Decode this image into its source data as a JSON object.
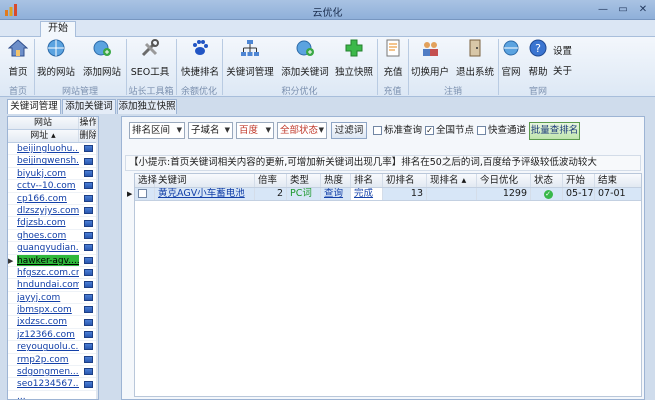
{
  "window": {
    "title": "云优化",
    "controls": [
      "—",
      "▭",
      "✕"
    ]
  },
  "menu": {
    "tab": "开始"
  },
  "ribbon": {
    "buttons": [
      {
        "id": "home",
        "label": "首页",
        "icon": "home-icon"
      },
      {
        "id": "my-sites",
        "label": "我的网站",
        "icon": "globe-icon"
      },
      {
        "id": "add-site",
        "label": "添加网站",
        "icon": "globe-add-icon"
      },
      {
        "id": "seo-tools",
        "label": "SEO工具",
        "icon": "tools-icon"
      },
      {
        "id": "quick-rank",
        "label": "快捷排名",
        "icon": "paw-icon"
      },
      {
        "id": "keyword-mgmt",
        "label": "关键词管理",
        "icon": "network-icon"
      },
      {
        "id": "add-keyword",
        "label": "添加关键词",
        "icon": "globe-plus-icon"
      },
      {
        "id": "standalone-snapshot",
        "label": "独立快照",
        "icon": "plus-icon"
      },
      {
        "id": "recharge",
        "label": "充值",
        "icon": "document-icon"
      },
      {
        "id": "switch-user",
        "label": "切换用户",
        "icon": "users-icon"
      },
      {
        "id": "logout",
        "label": "退出系统",
        "icon": "exit-icon"
      },
      {
        "id": "official-site",
        "label": "官网",
        "icon": "house-globe-icon"
      },
      {
        "id": "help",
        "label": "帮助",
        "icon": "help-icon"
      },
      {
        "id": "settings",
        "label": "设置",
        "icon": ""
      },
      {
        "id": "about",
        "label": "关于",
        "icon": ""
      }
    ],
    "groups": [
      "首页",
      "网站管理",
      "站长工具箱",
      "余额优化",
      "积分优化",
      "充值",
      "注销",
      "官网"
    ]
  },
  "content_tabs": [
    "关键词管理",
    "添加关键词",
    "添加独立快照"
  ],
  "site_list": {
    "headers": {
      "site": "网站",
      "col_site": "网址",
      "op": "操作",
      "delete": "删除"
    },
    "items": [
      "beijingluohu...",
      "beijingwensh...",
      "biyukj.com",
      "cctv--10.com",
      "cp166.com",
      "dlzszyjys.com",
      "fdjzsb.com",
      "ghoes.com",
      "guangyudian...",
      "hawker-agv....",
      "hfgszc.com.cn",
      "hndundai.com",
      "jayyj.com",
      "jbmspx.com",
      "jxdzsc.com",
      "jz12366.com",
      "reyouguolu.c...",
      "rmp2p.com",
      "sdgongmen....",
      "seo1234567....",
      "..."
    ],
    "selected_index": 9
  },
  "filters": {
    "rank_range": "排名区间",
    "subdomain": "子域名",
    "engine": "百度",
    "status": "全部状态",
    "filter_button": "过滤词",
    "checkbox_query": "标准查询",
    "checkbox_national": "全国节点",
    "checkbox_fast": "快查通道",
    "batch_button": "批量查排名",
    "checked": {
      "query": false,
      "national": true,
      "fast": false
    }
  },
  "tip": {
    "prefix": "【小提示:首页关键词相关内容的更新,可增加新关键词出现几率】",
    "suffix": "排名在50之后的词,百度给予评级较低波动较大"
  },
  "keyword_table": {
    "headers": [
      "选择",
      "关键词",
      "倍率",
      "类型",
      "热度",
      "排名",
      "初排名",
      "现排名",
      "今日优化",
      "状态",
      "开始",
      "结束"
    ],
    "rows": [
      {
        "keyword": "黄克AGV小车蓄电池",
        "multiplier": "2",
        "type": "PC词",
        "heat": "查询",
        "rank": "完成",
        "init_rank": "13",
        "current_rank": "",
        "today": "1299",
        "status": "ok",
        "start": "05-17",
        "end": "07-01"
      }
    ]
  },
  "colors": {
    "accent": "#2fb83c",
    "link": "#1340a8",
    "ribbon": "#dde8f5"
  }
}
